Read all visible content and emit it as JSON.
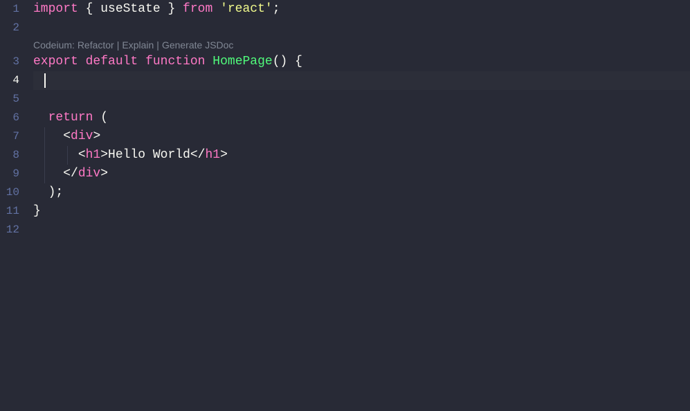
{
  "lineNumbers": [
    "1",
    "2",
    "3",
    "4",
    "5",
    "6",
    "7",
    "8",
    "9",
    "10",
    "11",
    "12"
  ],
  "activeLine": 4,
  "codelens": {
    "prefix": "Codeium:",
    "actions": [
      "Refactor",
      "Explain",
      "Generate JSDoc"
    ],
    "separator": "|"
  },
  "code": {
    "line1": {
      "import": "import",
      "lbrace": " { ",
      "useState": "useState",
      "rbrace": " } ",
      "from": "from",
      "space": " ",
      "string": "'react'",
      "semi": ";"
    },
    "line3": {
      "export": "export",
      "default": "default",
      "function": "function",
      "name": "HomePage",
      "parens": "()",
      "lbrace": " {"
    },
    "line6": {
      "return": "return",
      "lparen": " ("
    },
    "line7": {
      "lt": "<",
      "tag": "div",
      "gt": ">"
    },
    "line8": {
      "lt1": "<",
      "h1open": "h1",
      "gt1": ">",
      "text": "Hello World",
      "lt2": "</",
      "h1close": "h1",
      "gt2": ">"
    },
    "line9": {
      "lt": "</",
      "tag": "div",
      "gt": ">"
    },
    "line10": {
      "rparen": ")",
      "semi": ";"
    },
    "line11": {
      "rbrace": "}"
    }
  }
}
